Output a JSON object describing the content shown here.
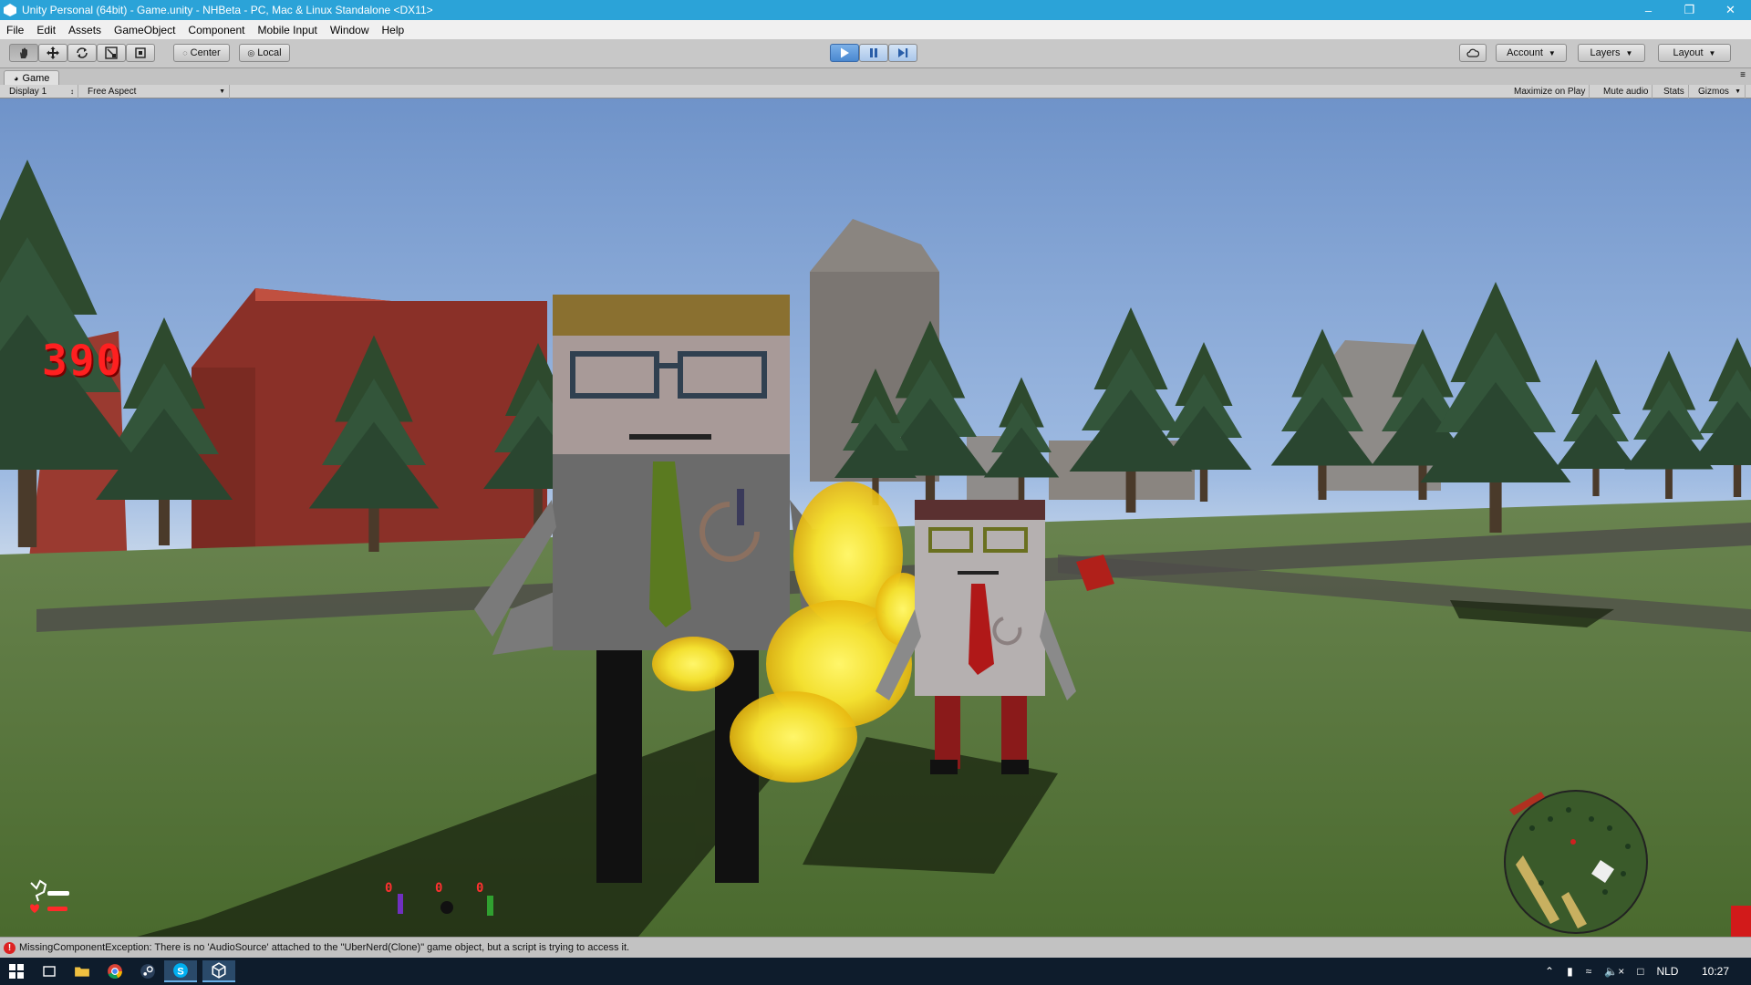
{
  "window": {
    "title": "Unity Personal (64bit) - Game.unity - NHBeta - PC, Mac & Linux Standalone <DX11>",
    "minimize": "–",
    "maximize": "❐",
    "close": "✕"
  },
  "menu": [
    "File",
    "Edit",
    "Assets",
    "GameObject",
    "Component",
    "Mobile Input",
    "Window",
    "Help"
  ],
  "toolbar": {
    "pivot_label": "Center",
    "space_label": "Local",
    "account_label": "Account",
    "layers_label": "Layers",
    "layout_label": "Layout",
    "play_state": "playing"
  },
  "game_view": {
    "tab_label": "Game",
    "display_label": "Display 1",
    "aspect_label": "Free Aspect",
    "maximize_label": "Maximize on Play",
    "mute_label": "Mute audio",
    "stats_label": "Stats",
    "gizmos_label": "Gizmos"
  },
  "hud": {
    "score": "390",
    "ammo": [
      {
        "count": "0",
        "item": "purple-bottle"
      },
      {
        "count": "0",
        "item": "bomb"
      },
      {
        "count": "0",
        "item": "green-bottle"
      }
    ],
    "minimap_present": true
  },
  "status": {
    "message": "MissingComponentException: There is no 'AudioSource' attached to the \"UberNerd(Clone)\" game object, but a script is trying to access it."
  },
  "taskbar": {
    "language": "NLD",
    "time": "10:27"
  },
  "colors": {
    "titlebar": "#2ba3d8",
    "sky_top": "#6f93c9",
    "grass": "#5a7a3a",
    "score": "#ff2020"
  }
}
